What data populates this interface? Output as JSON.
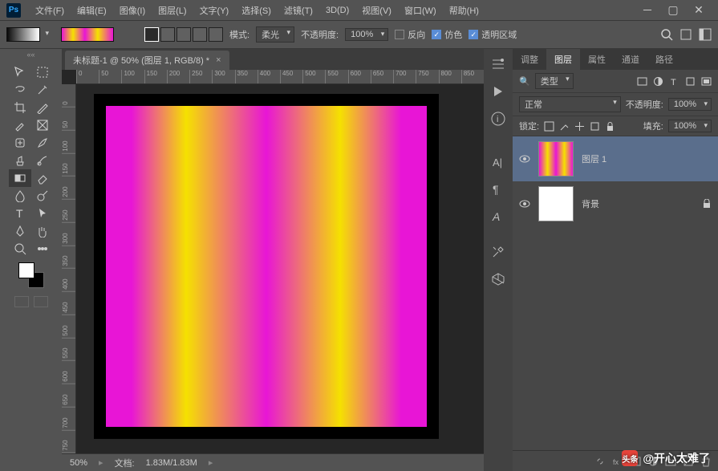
{
  "menubar": {
    "items": [
      "文件(F)",
      "编辑(E)",
      "图像(I)",
      "图层(L)",
      "文字(Y)",
      "选择(S)",
      "滤镜(T)",
      "3D(D)",
      "视图(V)",
      "窗口(W)",
      "帮助(H)"
    ]
  },
  "optbar": {
    "mode_label": "模式:",
    "mode_value": "柔光",
    "opacity_label": "不透明度:",
    "opacity_value": "100%",
    "chk_reverse": "反向",
    "chk_dither": "仿色",
    "chk_transparent": "透明区域"
  },
  "document": {
    "tab_title": "未标题-1 @ 50% (图层 1, RGB/8) *",
    "ruler_h": [
      "0",
      "50",
      "100",
      "150",
      "200",
      "250",
      "300",
      "350",
      "400",
      "450",
      "500",
      "550",
      "600",
      "650",
      "700",
      "750",
      "800",
      "850"
    ],
    "ruler_v": [
      "0",
      "50",
      "100",
      "150",
      "200",
      "250",
      "300",
      "350",
      "400",
      "450",
      "500",
      "550",
      "600",
      "650",
      "700",
      "750"
    ]
  },
  "status": {
    "zoom": "50%",
    "docinfo_label": "文档:",
    "docinfo_value": "1.83M/1.83M"
  },
  "panels": {
    "tabs": [
      "调整",
      "图层",
      "属性",
      "通道",
      "路径"
    ],
    "active_tab": 1,
    "layer_filter_label": "类型",
    "blend_mode": "正常",
    "opacity_label": "不透明度:",
    "opacity_value": "100%",
    "lock_label": "锁定:",
    "fill_label": "填充:",
    "fill_value": "100%",
    "layers": [
      {
        "name": "图层 1",
        "thumb": "grad",
        "active": true,
        "locked": false
      },
      {
        "name": "背景",
        "thumb": "white",
        "active": false,
        "locked": true
      }
    ]
  },
  "watermark": {
    "prefix": "头条",
    "author": "@开心太难了"
  }
}
